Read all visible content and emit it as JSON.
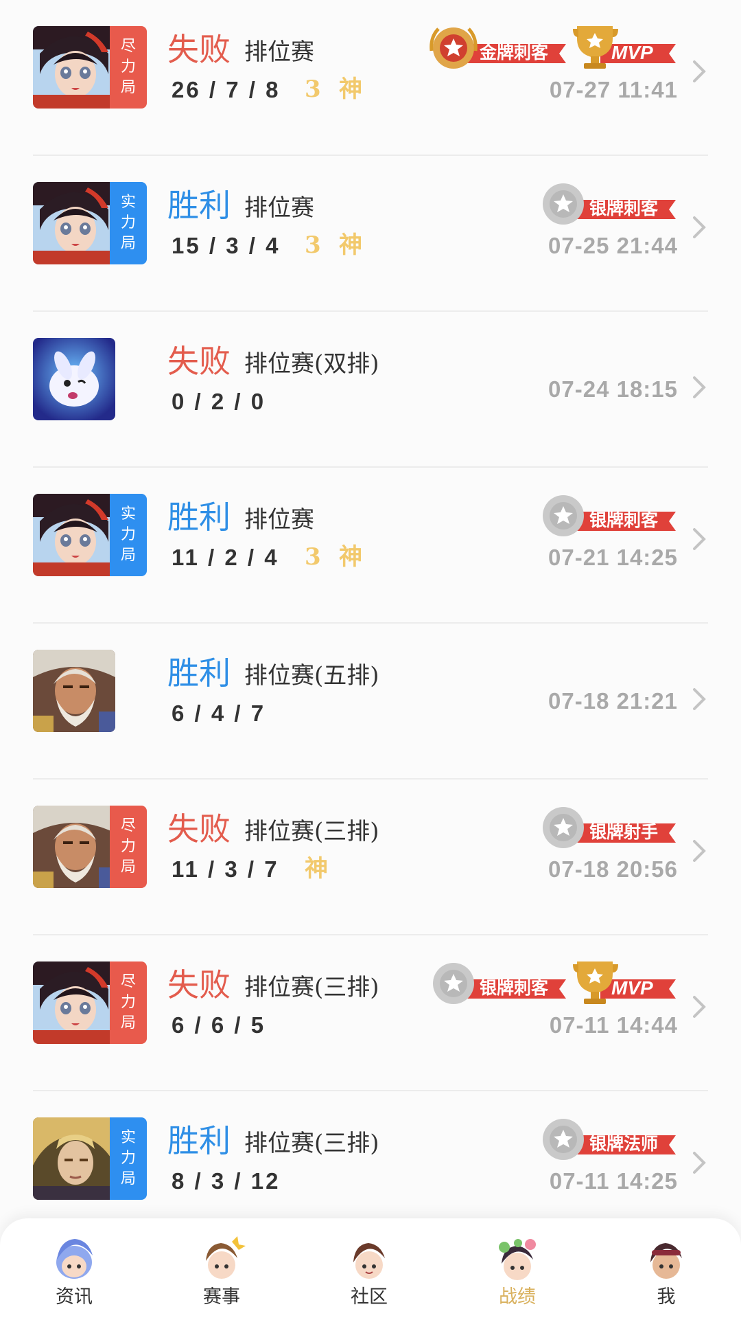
{
  "matches": [
    {
      "result": "失败",
      "result_type": "lose",
      "mode_tag": [
        "尽",
        "力",
        "局"
      ],
      "mode_color": "red",
      "match_type": "排位赛",
      "kda": "26 / 7 / 8",
      "flags": [
        "3",
        "神"
      ],
      "badges": [
        {
          "kind": "gold",
          "label": "金牌刺客"
        },
        {
          "kind": "mvp",
          "label": "MVP"
        }
      ],
      "time": "07-27 11:41",
      "hero": "girl"
    },
    {
      "result": "胜利",
      "result_type": "win",
      "mode_tag": [
        "实",
        "力",
        "局"
      ],
      "mode_color": "blue",
      "match_type": "排位赛",
      "kda": "15 / 3 / 4",
      "flags": [
        "3",
        "神"
      ],
      "badges": [
        {
          "kind": "silver",
          "label": "银牌刺客"
        }
      ],
      "time": "07-25 21:44",
      "hero": "girl"
    },
    {
      "result": "失败",
      "result_type": "lose",
      "mode_tag": [],
      "mode_color": "",
      "match_type": "排位赛(双排)",
      "kda": "0 / 2 / 0",
      "flags": [],
      "badges": [],
      "time": "07-24 18:15",
      "hero": "spirit"
    },
    {
      "result": "胜利",
      "result_type": "win",
      "mode_tag": [
        "实",
        "力",
        "局"
      ],
      "mode_color": "blue",
      "match_type": "排位赛",
      "kda": "11 / 2 / 4",
      "flags": [
        "3",
        "神"
      ],
      "badges": [
        {
          "kind": "silver",
          "label": "银牌刺客"
        }
      ],
      "time": "07-21 14:25",
      "hero": "girl"
    },
    {
      "result": "胜利",
      "result_type": "win",
      "mode_tag": [],
      "mode_color": "",
      "match_type": "排位赛(五排)",
      "kda": "6 / 4 / 7",
      "flags": [],
      "badges": [],
      "time": "07-18 21:21",
      "hero": "oldman"
    },
    {
      "result": "失败",
      "result_type": "lose",
      "mode_tag": [
        "尽",
        "力",
        "局"
      ],
      "mode_color": "red",
      "match_type": "排位赛(三排)",
      "kda": "11 / 3 / 7",
      "flags": [
        "神"
      ],
      "badges": [
        {
          "kind": "silver",
          "label": "银牌射手"
        }
      ],
      "time": "07-18 20:56",
      "hero": "oldman"
    },
    {
      "result": "失败",
      "result_type": "lose",
      "mode_tag": [
        "尽",
        "力",
        "局"
      ],
      "mode_color": "red",
      "match_type": "排位赛(三排)",
      "kda": "6 / 6 / 5",
      "flags": [],
      "badges": [
        {
          "kind": "silver",
          "label": "银牌刺客"
        },
        {
          "kind": "mvp",
          "label": "MVP"
        }
      ],
      "time": "07-11 14:44",
      "hero": "girl"
    },
    {
      "result": "胜利",
      "result_type": "win",
      "mode_tag": [
        "实",
        "力",
        "局"
      ],
      "mode_color": "blue",
      "match_type": "排位赛(三排)",
      "kda": "8 / 3 / 12",
      "flags": [],
      "badges": [
        {
          "kind": "silver",
          "label": "银牌法师"
        }
      ],
      "time": "07-11 14:25",
      "hero": "blond"
    }
  ],
  "tabs": [
    {
      "label": "资讯",
      "icon": "news-avatar-icon",
      "active": false
    },
    {
      "label": "赛事",
      "icon": "events-avatar-icon",
      "active": false
    },
    {
      "label": "社区",
      "icon": "community-avatar-icon",
      "active": false
    },
    {
      "label": "战绩",
      "icon": "record-avatar-icon",
      "active": true
    },
    {
      "label": "我",
      "icon": "me-avatar-icon",
      "active": false
    }
  ],
  "colors": {
    "lose": "#e35c4d",
    "win": "#2f8fe6",
    "tag_red": "#e85a4c",
    "tag_blue": "#2e8ff0",
    "flag": "#f2c96c",
    "active_tab": "#d9b15e"
  }
}
